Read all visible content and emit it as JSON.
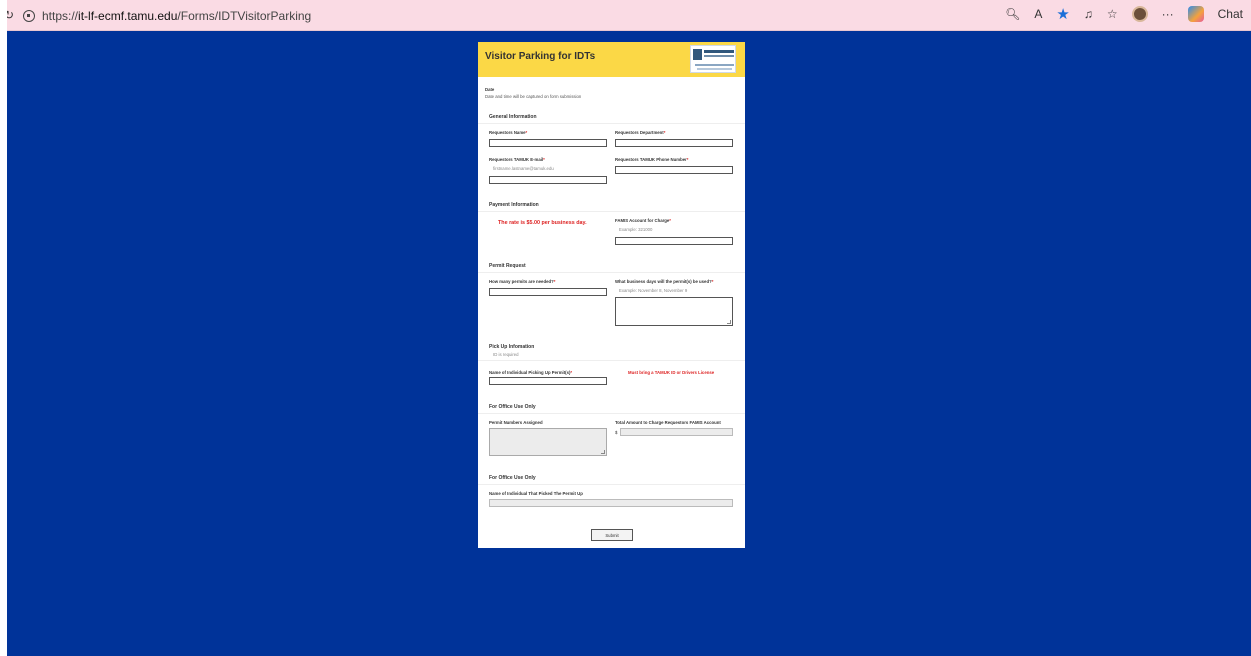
{
  "browser": {
    "url_prefix": "https://",
    "url_host": "it-lf-ecmf.tamu.edu",
    "url_path": "/Forms/IDTVisitorParking",
    "chat_label": "Chat"
  },
  "form": {
    "title": "Visitor Parking for IDTs",
    "date_label": "Date",
    "date_hint": "Date and time will be captured on form submission",
    "general": {
      "heading": "General Information",
      "name_label": "Requestors Name",
      "dept_label": "Requestors Department",
      "email_label": "Requestors TAMUK E-mail",
      "email_hint": "firstname.lastname@tamuk.edu",
      "phone_label": "Requestors TAMUK Phone Number"
    },
    "payment": {
      "heading": "Payment Information",
      "rate_text": "The rate is $5.00 per business day.",
      "famis_label": "FAMIS Account for Charge",
      "famis_hint": "Example: 321000"
    },
    "permit": {
      "heading": "Permit Request",
      "count_label": "How many permits are needed?",
      "days_label": "What business days will the permit(s) be used?",
      "days_hint": "Example: November 8, November 9"
    },
    "pickup": {
      "heading": "Pick Up Infomation",
      "hint": "ID is required",
      "name_label": "Name of Individual Picking Up Permit(s)",
      "must_bring": "Must bring a TAMUK ID or Drivers License"
    },
    "office1": {
      "heading": "For Office Use Only",
      "numbers_label": "Permit Numbers Assigned",
      "amount_label": "Total Amount to Charge Requestors FAMIS Account",
      "currency": "$"
    },
    "office2": {
      "heading": "For Office Use Only",
      "picked_label": "Name of Individual That Picked The Permit Up"
    },
    "required_mark": "*",
    "submit_label": "Submit"
  },
  "colors": {
    "page_bg": "#003399",
    "header_bg": "#fbd846",
    "required": "#dd2222"
  }
}
